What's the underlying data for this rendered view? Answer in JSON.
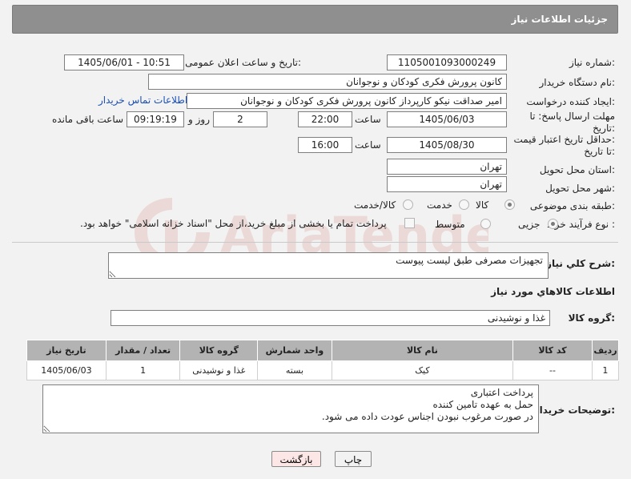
{
  "header": {
    "title": "جزئیات اطلاعات نیاز"
  },
  "fields": {
    "need_number_label": "شماره نیاز:",
    "need_number": "1105001093000249",
    "announce_label": "تاریخ و ساعت اعلان عمومی:",
    "announce_value": "1405/06/01 - 10:51",
    "buyer_label": "نام دستگاه خریدار:",
    "buyer_value": "کانون پرورش فکری کودکان و نوجوانان",
    "creator_label": "ایجاد کننده درخواست:",
    "creator_value": "امیر صداقت نیکو کارپرداز کانون پرورش فکری کودکان و نوجوانان",
    "contact_link": "اطلاعات تماس خریدار",
    "deadline_label_1": "مهلت ارسال پاسخ: تا",
    "deadline_label_2": "تاریخ:",
    "deadline_date": "1405/06/03",
    "time_label": "ساعت",
    "deadline_time": "22:00",
    "days_value": "2",
    "days_label": "روز و",
    "remaining_value": "09:19:19",
    "remaining_label": "ساعت باقی مانده",
    "min_validity_label_1": "حداقل تاریخ اعتبار قیمت:",
    "min_validity_label_2": "تا تاریخ:",
    "validity_date": "1405/08/30",
    "validity_time": "16:00",
    "province_label": "استان محل تحویل:",
    "province_value": "تهران",
    "city_label": "شهر محل تحویل:",
    "city_value": "تهران",
    "category_label": "طبقه بندی موضوعی:",
    "category_options": [
      "کالا",
      "خدمت",
      "کالا/خدمت"
    ],
    "process_label": "نوع فرآیند خرید :",
    "process_options": [
      "جزیی",
      "متوسط"
    ],
    "payment_note": "پرداخت تمام یا بخشی از مبلغ خرید،از محل \"اسناد خزانه اسلامی\" خواهد بود."
  },
  "summary": {
    "label": "شرح کلي نياز:",
    "value": "تجهیزات مصرفی طبق لیست پیوست"
  },
  "goods_section": {
    "title": "اطلاعات کالاهاي مورد نياز"
  },
  "goods_group": {
    "label": "گروه کالا:",
    "value": "غذا و نوشیدنی"
  },
  "table": {
    "headers": [
      "ردیف",
      "کد کالا",
      "نام کالا",
      "واحد شمارش",
      "گروه کالا",
      "تعداد / مقدار",
      "تاریخ نیاز"
    ],
    "rows": [
      [
        "1",
        "--",
        "کیک",
        "بسته",
        "غذا و نوشیدنی",
        "1",
        "1405/06/03"
      ]
    ]
  },
  "buyer_notes": {
    "label": "توضیحات خریدار:",
    "value": "پرداخت اعتباری\nحمل به عهده تامین کننده\nدر صورت مرغوب نبودن اجناس عودت داده می شود."
  },
  "buttons": {
    "print": "چاپ",
    "back": "بازگشت"
  },
  "watermark": {
    "text": "AriaTender.net"
  },
  "colors": {
    "header": "#8f8f8f",
    "table_header": "#b3b3b3",
    "back_button": "#fde6e6",
    "link": "#1a4fb5"
  }
}
